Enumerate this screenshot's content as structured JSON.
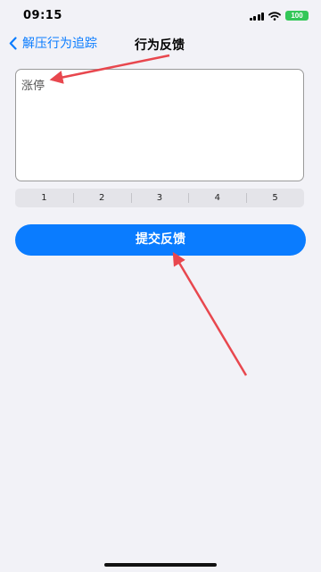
{
  "status_bar": {
    "time": "09:15",
    "battery": "100"
  },
  "nav": {
    "back_label": "解压行为追踪",
    "title": "行为反馈"
  },
  "feedback": {
    "text": "涨停"
  },
  "suggestions": [
    "1",
    "2",
    "3",
    "4",
    "5"
  ],
  "submit_label": "提交反馈",
  "colors": {
    "accent": "#0a7cff",
    "annotation_arrow": "#e8474e",
    "battery": "#34c759"
  },
  "icons": [
    "cellular-signal-icon",
    "wifi-icon",
    "back-chevron-icon"
  ]
}
